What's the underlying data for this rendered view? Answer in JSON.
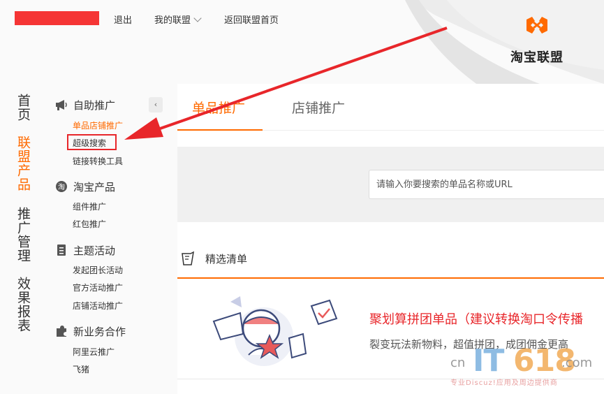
{
  "top_bar": {
    "logout": "退出",
    "my_alliance": "我的联盟",
    "back_home": "返回联盟首页"
  },
  "brand": {
    "name": "淘宝联盟",
    "accent": "#ff6a00"
  },
  "left_nav": [
    "首页",
    "联盟产品",
    "推广管理",
    "效果报表"
  ],
  "groups": [
    {
      "icon": "megaphone-icon",
      "title": "自助推广",
      "items": [
        "单品店铺推广",
        "超级搜索",
        "链接转换工具"
      ]
    },
    {
      "icon": "taobao-icon",
      "title": "淘宝产品",
      "items": [
        "组件推广",
        "红包推广"
      ]
    },
    {
      "icon": "document-icon",
      "title": "主题活动",
      "items": [
        "发起团长活动",
        "官方活动推广",
        "店铺活动推广"
      ]
    },
    {
      "icon": "puzzle-icon",
      "title": "新业务合作",
      "items": [
        "阿里云推广",
        "飞猪"
      ]
    }
  ],
  "collapse_glyph": "‹",
  "tabs": [
    "单品推广",
    "店铺推广"
  ],
  "search": {
    "placeholder": "请输入你要搜索的单品名称或URL"
  },
  "list": {
    "title": "精选清单",
    "item": {
      "title": "聚划算拼团单品（建议转换淘口令传播",
      "desc": "裂变玩法新物料，超值拼团，成团佣金更高"
    }
  },
  "watermark": {
    "cn": "cn",
    "it": "IT",
    "num": "618",
    "com": ".com",
    "tagline": "专业Discuz!应用及周边提供商"
  }
}
